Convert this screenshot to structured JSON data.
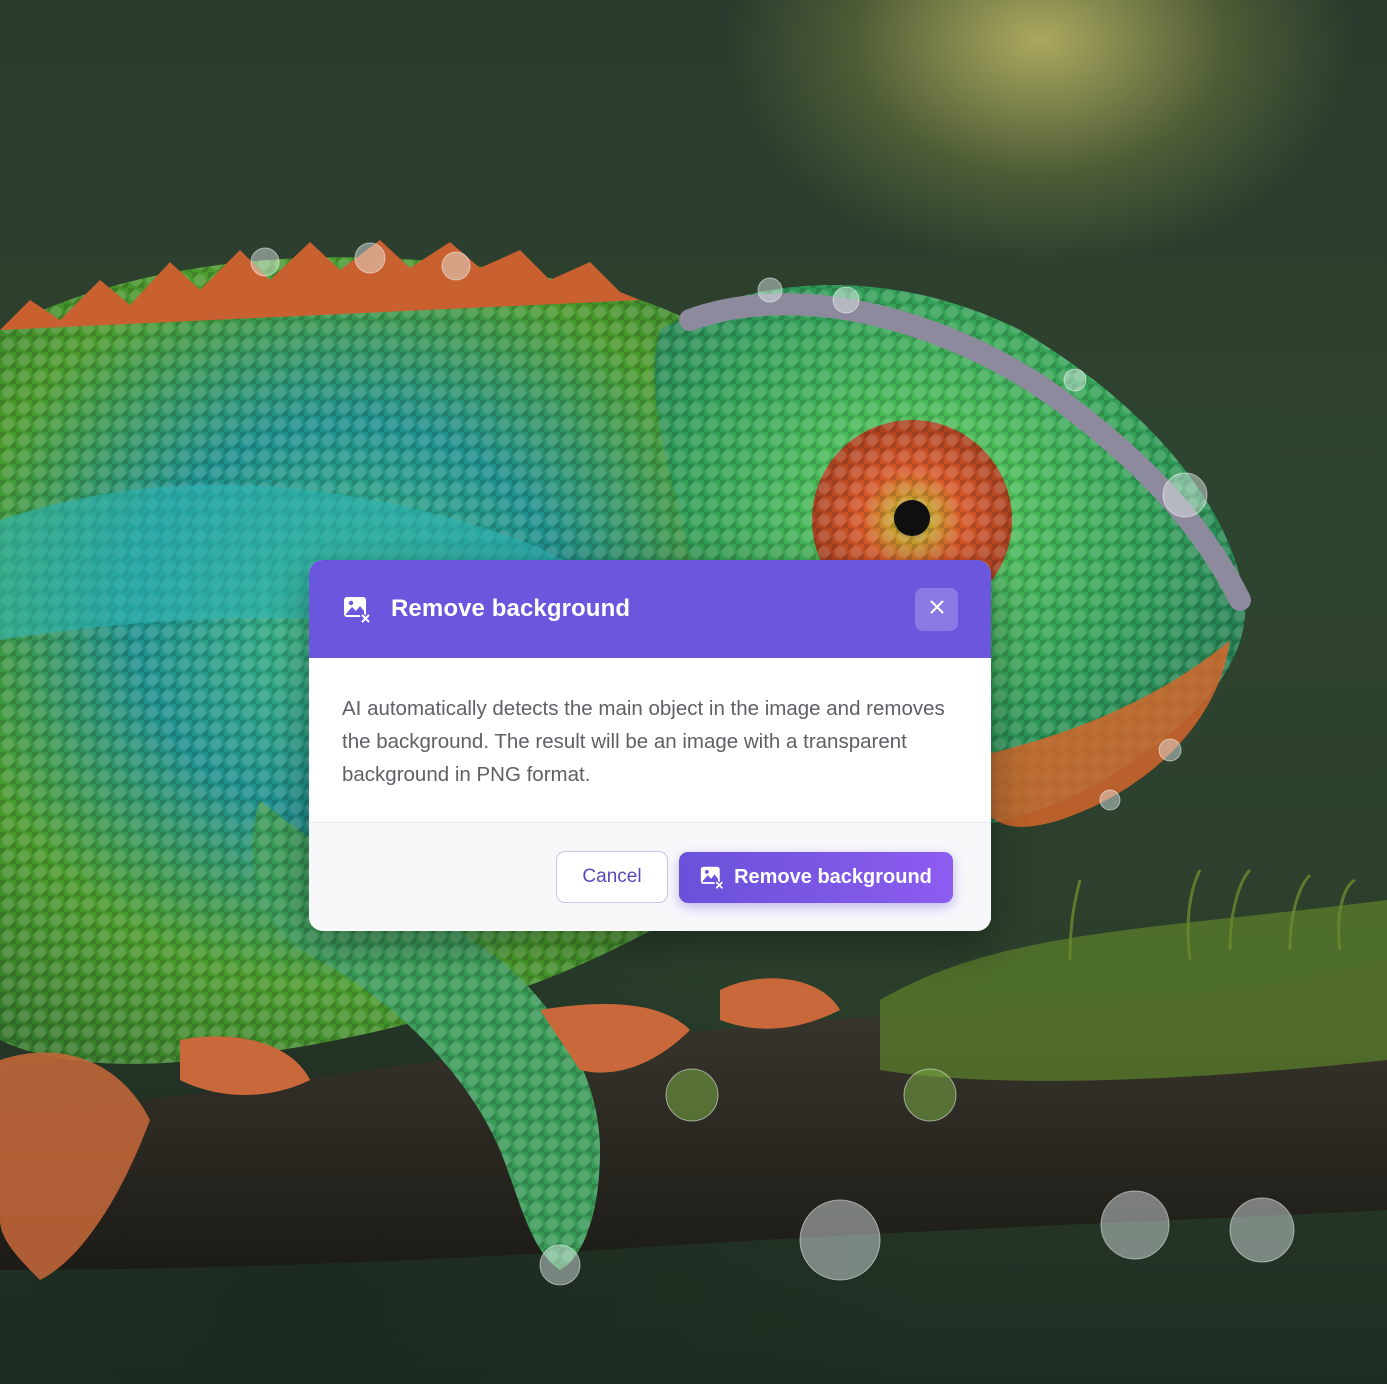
{
  "background": {
    "image_icon": "chameleon-photo"
  },
  "dialog": {
    "title": "Remove background",
    "title_icon": "remove-background-icon",
    "close_icon": "close-icon",
    "description": "AI automatically detects the main object in the image and removes the background. The result will be an image with a transparent background in PNG format.",
    "cancel_label": "Cancel",
    "confirm_label": "Remove background",
    "confirm_icon": "remove-background-icon"
  },
  "colors": {
    "accent": "#6a57dd",
    "accent_gradient_end": "#8c5cf0",
    "body_text": "#5f5f66",
    "cancel_text": "#5a47b8"
  }
}
